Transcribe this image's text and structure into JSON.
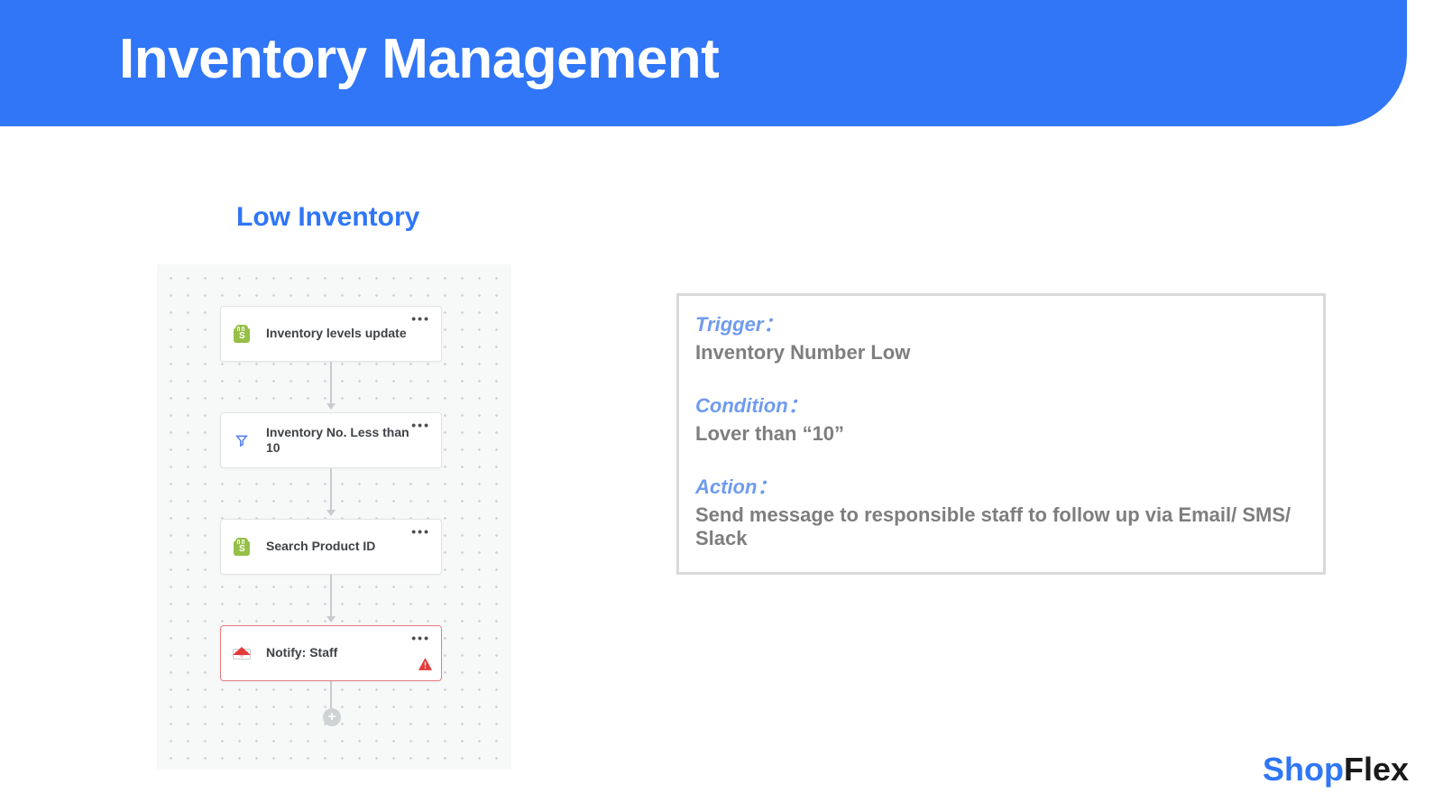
{
  "header": {
    "title": "Inventory Management"
  },
  "subtitle": "Low Inventory",
  "flow": {
    "nodes": [
      {
        "label": "Inventory levels update",
        "icon": "shopify-icon"
      },
      {
        "label": "Inventory No. Less than 10",
        "icon": "filter-icon"
      },
      {
        "label": "Search Product ID",
        "icon": "shopify-icon"
      },
      {
        "label": "Notify: Staff",
        "icon": "mail-icon",
        "alert": true
      }
    ],
    "add_button": "+"
  },
  "info": {
    "trigger_label": "Trigger：",
    "trigger_value": "Inventory Number Low",
    "condition_label": "Condition：",
    "condition_value": "Lover than “10”",
    "action_label": "Action：",
    "action_value": "Send message to responsible staff to follow up via Email/ SMS/ Slack"
  },
  "logo": {
    "part1": "Shop",
    "part2": "Flex"
  }
}
